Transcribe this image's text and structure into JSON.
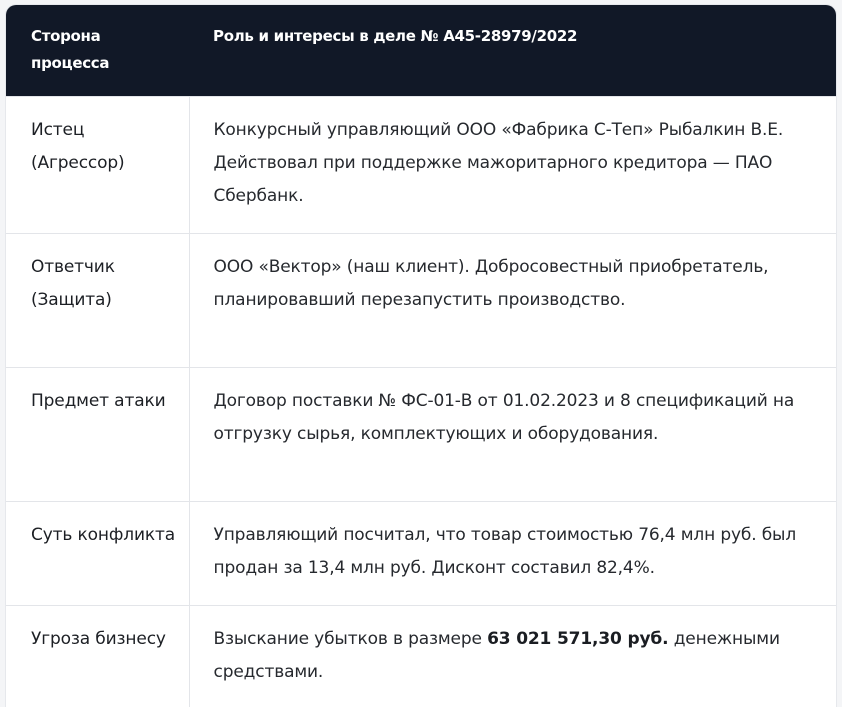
{
  "header": {
    "col1": "Сторона процесса",
    "col2": "Роль и интересы в деле № А45-28979/2022"
  },
  "rows": [
    {
      "side": "Истец (Агрессор)",
      "role": "Конкурсный управляющий ООО «Фабрика С-Теп» Рыбалкин В.Е. Действовал при поддержке мажоритарного кредитора — ПАО Сбербанк."
    },
    {
      "side": "Ответчик (Защита)",
      "role": "ООО «Вектор» (наш клиент). Добросовестный приобретатель, планировавший перезапустить производство."
    },
    {
      "side": "Предмет атаки",
      "role": "Договор поставки № ФС-01-В от 01.02.2023 и 8 спецификаций на отгрузку сырья, комплектующих и оборудования."
    },
    {
      "side": "Суть конфликта",
      "role": "Управляющий посчитал, что товар стоимостью 76,4 млн руб. был продан за 13,4 млн руб. Дисконт составил 82,4%."
    },
    {
      "side": "Угроза бизнесу",
      "role_before": "Взыскание убытков в размере ",
      "role_bold": "63 021 571,30 руб.",
      "role_after": " денежными средствами."
    }
  ]
}
